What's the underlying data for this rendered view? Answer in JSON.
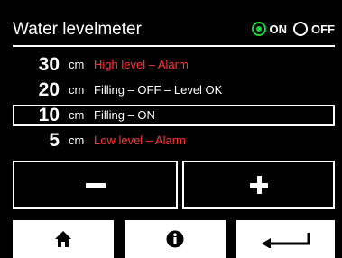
{
  "header": {
    "title": "Water levelmeter",
    "radio_on_label": "ON",
    "radio_off_label": "OFF",
    "selected": "ON"
  },
  "levels": [
    {
      "value": "30",
      "unit": "cm",
      "description": "High level – Alarm",
      "alarm": true,
      "selected": false
    },
    {
      "value": "20",
      "unit": "cm",
      "description": "Filling – OFF – Level OK",
      "alarm": false,
      "selected": false
    },
    {
      "value": "10",
      "unit": "cm",
      "description": "Filling – ON",
      "alarm": false,
      "selected": true
    },
    {
      "value": "5",
      "unit": "cm",
      "description": "Low level – Alarm",
      "alarm": true,
      "selected": false
    }
  ],
  "buttons": {
    "decrease_icon": "minus-icon",
    "increase_icon": "plus-icon"
  },
  "nav": {
    "home_icon": "home-icon",
    "info_icon": "info-icon",
    "back_icon": "back-arrow-icon"
  },
  "colors": {
    "background": "#000000",
    "foreground": "#ffffff",
    "alarm": "#ff3636",
    "radio_active": "#1fd33a"
  }
}
